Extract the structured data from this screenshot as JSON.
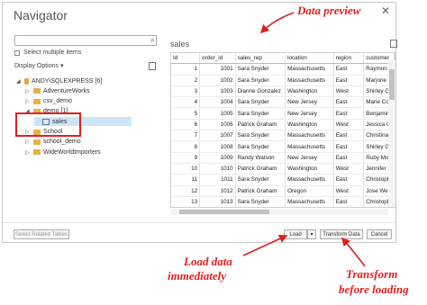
{
  "window": {
    "title": "Navigator",
    "close_glyph": "✕"
  },
  "search": {
    "icon": "search-icon"
  },
  "select_multiple": {
    "label": "Select multiple items"
  },
  "display_options": {
    "label": "Display Options ▾"
  },
  "tree": [
    {
      "label": "ANDY\\SQLEXPRESS [6]",
      "kind": "server",
      "expanded": true,
      "indent": 0
    },
    {
      "label": "AdventureWorks",
      "kind": "db",
      "indent": 1
    },
    {
      "label": "csv_demo",
      "kind": "db",
      "indent": 1
    },
    {
      "label": "demo [1]",
      "kind": "db",
      "expanded": true,
      "indent": 1
    },
    {
      "label": "sales",
      "kind": "table",
      "selected": true,
      "indent": 2
    },
    {
      "label": "School",
      "kind": "db",
      "indent": 1
    },
    {
      "label": "school_demo",
      "kind": "db",
      "indent": 1
    },
    {
      "label": "WideWorldImporters",
      "kind": "db",
      "indent": 1
    }
  ],
  "preview": {
    "title": "sales",
    "columns": [
      "Id",
      "order_id",
      "sales_rep",
      "location",
      "region",
      "customer"
    ],
    "rows": [
      [
        "1",
        "1001",
        "Sara Snyder",
        "Massachusetts",
        "East",
        "Raymon"
      ],
      [
        "2",
        "1002",
        "Sara Snyder",
        "Massachusetts",
        "East",
        "Marjorie"
      ],
      [
        "3",
        "1003",
        "Dianne Gonzalez",
        "Washington",
        "West",
        "Shirley G"
      ],
      [
        "4",
        "1004",
        "Sara Snyder",
        "New Jersey",
        "East",
        "Marie Co"
      ],
      [
        "5",
        "1005",
        "Sara Snyder",
        "New Jersey",
        "East",
        "Benjamin"
      ],
      [
        "6",
        "1006",
        "Patrick Graham",
        "Washington",
        "West",
        "Jessica C"
      ],
      [
        "7",
        "1007",
        "Sara Snyder",
        "Massachusetts",
        "East",
        "Christina"
      ],
      [
        "8",
        "1008",
        "Sara Snyder",
        "Massachusetts",
        "East",
        "Shirley G"
      ],
      [
        "9",
        "1009",
        "Randy Watson",
        "New Jersey",
        "East",
        "Ruby Mo"
      ],
      [
        "10",
        "1010",
        "Patrick Graham",
        "Washington",
        "West",
        "Jennifer"
      ],
      [
        "11",
        "1011",
        "Sara Snyder",
        "Massachusetts",
        "East",
        "Christoph"
      ],
      [
        "12",
        "1012",
        "Patrick Graham",
        "Oregon",
        "West",
        "Jose Wei"
      ],
      [
        "13",
        "1013",
        "Sara Snyder",
        "Massachusetts",
        "East",
        "Christoph"
      ],
      [
        "14",
        "1014",
        "Sara Snyder",
        "Massachusetts",
        "East",
        "Marie Co"
      ],
      [
        "15",
        "1015",
        "Sara Snyder",
        "New Jersey",
        "East",
        "Jose Wei"
      ]
    ]
  },
  "buttons": {
    "select_related": "Select Related Tables",
    "load": "Load",
    "load_dropdown": "▾",
    "transform": "Transform Data",
    "cancel": "Cancel"
  },
  "annotations": {
    "data_preview": "Data preview",
    "load_line1": "Load data",
    "load_line2": "immediately",
    "transform_line1": "Transform",
    "transform_line2": "before loading"
  },
  "colors": {
    "annotation": "#e02020",
    "selection": "#cde6f7",
    "scroll_arrow_up": "▲",
    "scroll_arrow_down": "▼",
    "scroll_arrow_left": "◀",
    "scroll_arrow_right": "▶"
  }
}
